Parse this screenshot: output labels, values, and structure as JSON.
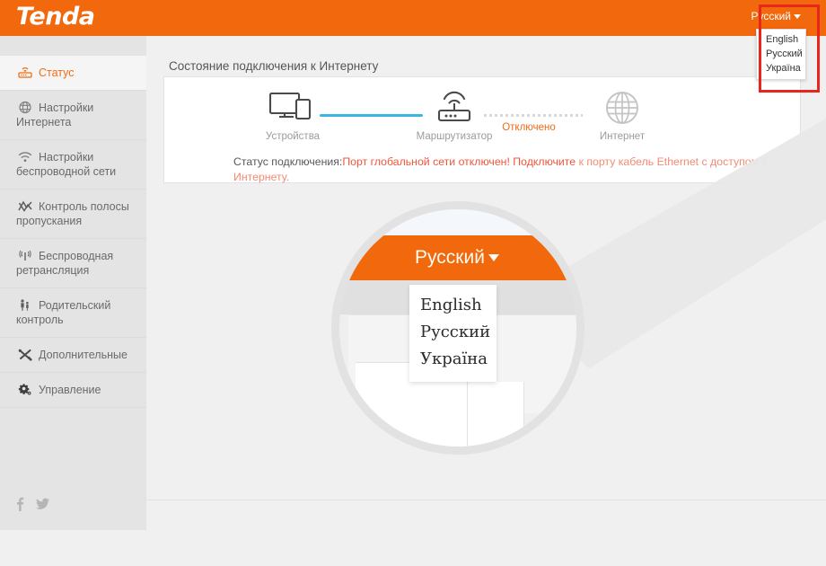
{
  "brand": {
    "name": "Tenda"
  },
  "language": {
    "current": "Русский",
    "options": [
      "English",
      "Русский",
      "Україна"
    ]
  },
  "sidebar": {
    "items": [
      {
        "label": "Статус",
        "icon": "router-icon",
        "active": true
      },
      {
        "label": "Настройки Интернета",
        "icon": "globe-icon",
        "active": false
      },
      {
        "label": "Настройки беспроводной сети",
        "icon": "wifi-icon",
        "active": false
      },
      {
        "label": "Контроль полосы пропускания",
        "icon": "bandwidth-chart-icon",
        "active": false
      },
      {
        "label": "Беспроводная ретрансляция",
        "icon": "antenna-icon",
        "active": false
      },
      {
        "label": "Родительский контроль",
        "icon": "parental-icon",
        "active": false
      },
      {
        "label": "Дополнительные",
        "icon": "tools-icon",
        "active": false
      },
      {
        "label": "Управление",
        "icon": "gear-icon",
        "active": false
      }
    ],
    "social": [
      "facebook-icon",
      "twitter-icon"
    ]
  },
  "main": {
    "title": "Состояние подключения к Интернету",
    "nodes": [
      {
        "label": "Устройства",
        "icon": "devices-icon"
      },
      {
        "label": "Маршрутизатор",
        "icon": "router-device-icon"
      },
      {
        "label": "Интернет",
        "icon": "globe-large-icon"
      }
    ],
    "link_state": "Отключено",
    "status": {
      "prefix": "Статус подключения:",
      "error": "Порт глобальной сети отключен! Подключите",
      "error_rest": "к порту кабель Ethernet с доступом к Интернету."
    }
  },
  "magnifier": {
    "lang_label": "Русский",
    "options": [
      "English",
      "Русский",
      "Україна"
    ]
  },
  "colors": {
    "brand_orange": "#f2680d",
    "accent_red": "#e8261c",
    "link_blue": "#3ab6e3",
    "error_red": "#f2563a"
  }
}
